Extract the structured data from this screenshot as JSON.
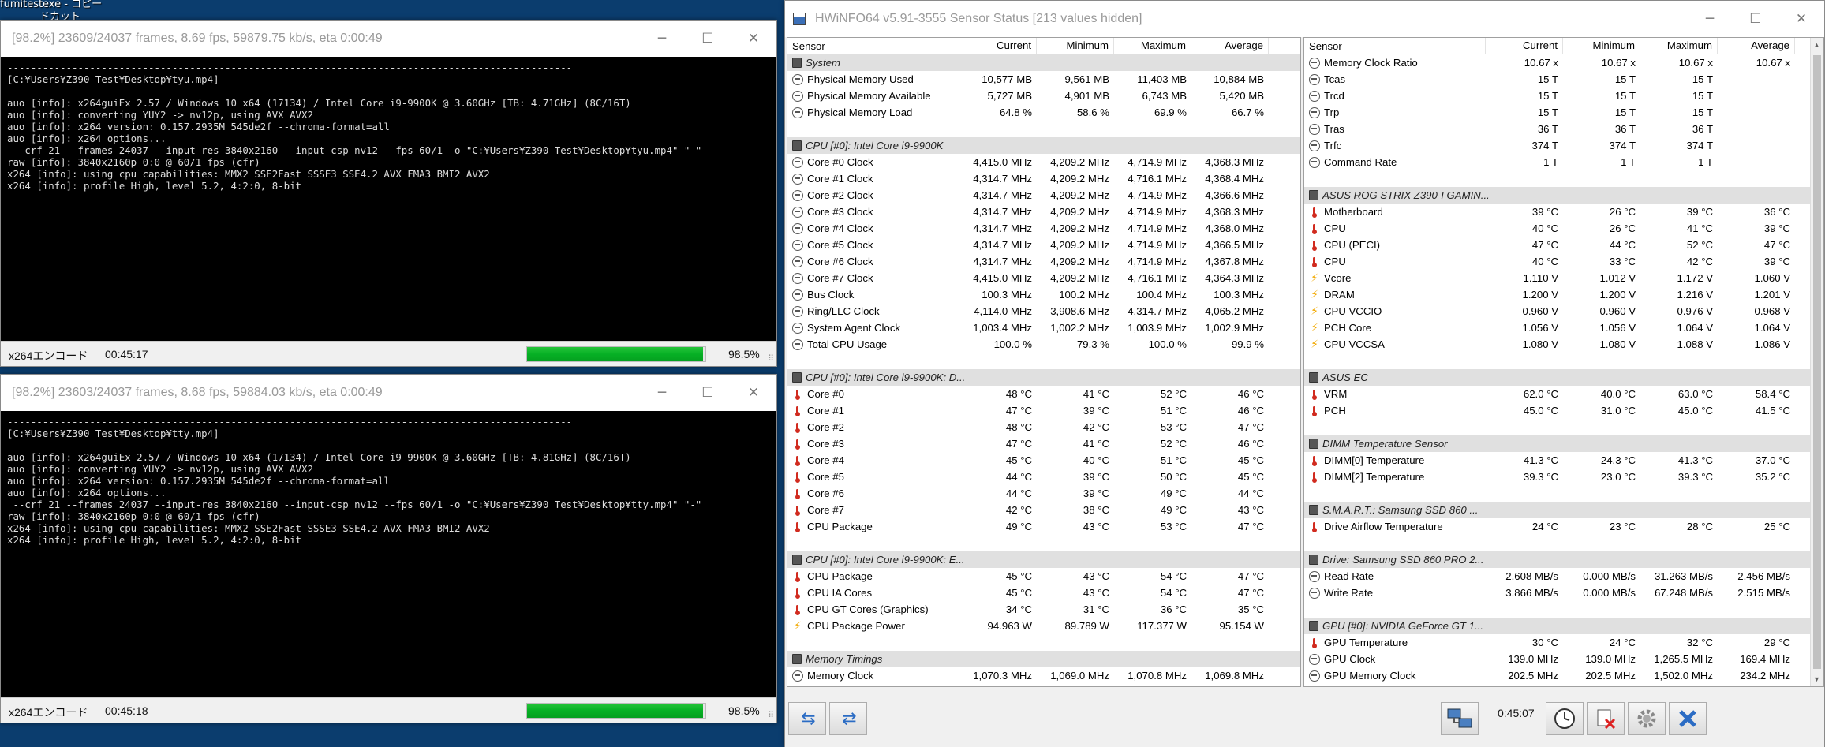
{
  "desktop": {
    "label1": "fumitestexe - コピー",
    "label2": "ドカット"
  },
  "console_windows": [
    {
      "title": "[98.2%] 23609/24037 frames, 8.69 fps, 59879.75 kb/s, eta 0:00:49",
      "lines": [
        "------------------------------------------------------------------------------------------------",
        "[C:¥Users¥Z390 Test¥Desktop¥tyu.mp4]",
        "------------------------------------------------------------------------------------------------",
        "auo [info]: x264guiEx 2.57 / Windows 10 x64 (17134) / Intel Core i9-9900K @ 3.60GHz [TB: 4.71GHz] (8C/16T)",
        "auo [info]: converting YUY2 -> nv12p, using AVX AVX2",
        "auo [info]: x264 version: 0.157.2935M 545de2f --chroma-format=all",
        "auo [info]: x264 options...",
        " --crf 21 --frames 24037 --input-res 3840x2160 --input-csp nv12 --fps 60/1 -o \"C:¥Users¥Z390 Test¥Desktop¥tyu.mp4\" \"-\"",
        "raw [info]: 3840x2160p 0:0 @ 60/1 fps (cfr)",
        "x264 [info]: using cpu capabilities: MMX2 SSE2Fast SSSE3 SSE4.2 AVX FMA3 BMI2 AVX2",
        "x264 [info]: profile High, level 5.2, 4:2:0, 8-bit"
      ],
      "status_name": "x264エンコード",
      "elapsed": "00:45:17",
      "progress": 0.985,
      "progress_text": "98.5%"
    },
    {
      "title": "[98.2%] 23603/24037 frames, 8.68 fps, 59884.03 kb/s, eta 0:00:49",
      "lines": [
        "------------------------------------------------------------------------------------------------",
        "[C:¥Users¥Z390 Test¥Desktop¥tty.mp4]",
        "------------------------------------------------------------------------------------------------",
        "auo [info]: x264guiEx 2.57 / Windows 10 x64 (17134) / Intel Core i9-9900K @ 3.60GHz [TB: 4.81GHz] (8C/16T)",
        "auo [info]: converting YUY2 -> nv12p, using AVX AVX2",
        "auo [info]: x264 version: 0.157.2935M 545de2f --chroma-format=all",
        "auo [info]: x264 options...",
        " --crf 21 --frames 24037 --input-res 3840x2160 --input-csp nv12 --fps 60/1 -o \"C:¥Users¥Z390 Test¥Desktop¥tty.mp4\" \"-\"",
        "raw [info]: 3840x2160p 0:0 @ 60/1 fps (cfr)",
        "x264 [info]: using cpu capabilities: MMX2 SSE2Fast SSSE3 SSE4.2 AVX FMA3 BMI2 AVX2",
        "x264 [info]: profile High, level 5.2, 4:2:0, 8-bit"
      ],
      "status_name": "x264エンコード",
      "elapsed": "00:45:18",
      "progress": 0.985,
      "progress_text": "98.5%"
    }
  ],
  "window_controls": {
    "minimize": "─",
    "maximize": "☐",
    "close": "✕"
  },
  "hwinfo": {
    "title": "HWiNFO64 v5.91-3555 Sensor Status [213 values hidden]",
    "headers": [
      "Sensor",
      "Current",
      "Minimum",
      "Maximum",
      "Average"
    ],
    "left_rows": [
      {
        "t": "g",
        "name": "System"
      },
      {
        "t": "s",
        "i": "circle",
        "name": "Physical Memory Used",
        "v": [
          "10,577 MB",
          "9,561 MB",
          "11,403 MB",
          "10,884 MB"
        ]
      },
      {
        "t": "s",
        "i": "circle",
        "name": "Physical Memory Available",
        "v": [
          "5,727 MB",
          "4,901 MB",
          "6,743 MB",
          "5,420 MB"
        ]
      },
      {
        "t": "s",
        "i": "circle",
        "name": "Physical Memory Load",
        "v": [
          "64.8 %",
          "58.6 %",
          "69.9 %",
          "66.7 %"
        ]
      },
      {
        "t": "b"
      },
      {
        "t": "g",
        "name": "CPU [#0]: Intel Core i9-9900K"
      },
      {
        "t": "s",
        "i": "circle",
        "name": "Core #0 Clock",
        "v": [
          "4,415.0 MHz",
          "4,209.2 MHz",
          "4,714.9 MHz",
          "4,368.3 MHz"
        ]
      },
      {
        "t": "s",
        "i": "circle",
        "name": "Core #1 Clock",
        "v": [
          "4,314.7 MHz",
          "4,209.2 MHz",
          "4,716.1 MHz",
          "4,368.4 MHz"
        ]
      },
      {
        "t": "s",
        "i": "circle",
        "name": "Core #2 Clock",
        "v": [
          "4,314.7 MHz",
          "4,209.2 MHz",
          "4,714.9 MHz",
          "4,366.6 MHz"
        ]
      },
      {
        "t": "s",
        "i": "circle",
        "name": "Core #3 Clock",
        "v": [
          "4,314.7 MHz",
          "4,209.2 MHz",
          "4,714.9 MHz",
          "4,368.3 MHz"
        ]
      },
      {
        "t": "s",
        "i": "circle",
        "name": "Core #4 Clock",
        "v": [
          "4,314.7 MHz",
          "4,209.2 MHz",
          "4,714.9 MHz",
          "4,368.0 MHz"
        ]
      },
      {
        "t": "s",
        "i": "circle",
        "name": "Core #5 Clock",
        "v": [
          "4,314.7 MHz",
          "4,209.2 MHz",
          "4,714.9 MHz",
          "4,366.5 MHz"
        ]
      },
      {
        "t": "s",
        "i": "circle",
        "name": "Core #6 Clock",
        "v": [
          "4,314.7 MHz",
          "4,209.2 MHz",
          "4,714.9 MHz",
          "4,367.8 MHz"
        ]
      },
      {
        "t": "s",
        "i": "circle",
        "name": "Core #7 Clock",
        "v": [
          "4,415.0 MHz",
          "4,209.2 MHz",
          "4,716.1 MHz",
          "4,364.3 MHz"
        ]
      },
      {
        "t": "s",
        "i": "circle",
        "name": "Bus Clock",
        "v": [
          "100.3 MHz",
          "100.2 MHz",
          "100.4 MHz",
          "100.3 MHz"
        ]
      },
      {
        "t": "s",
        "i": "circle",
        "name": "Ring/LLC Clock",
        "v": [
          "4,114.0 MHz",
          "3,908.6 MHz",
          "4,314.7 MHz",
          "4,065.2 MHz"
        ]
      },
      {
        "t": "s",
        "i": "circle",
        "name": "System Agent Clock",
        "v": [
          "1,003.4 MHz",
          "1,002.2 MHz",
          "1,003.9 MHz",
          "1,002.9 MHz"
        ]
      },
      {
        "t": "s",
        "i": "circle",
        "name": "Total CPU Usage",
        "v": [
          "100.0 %",
          "79.3 %",
          "100.0 %",
          "99.9 %"
        ]
      },
      {
        "t": "b"
      },
      {
        "t": "g",
        "name": "CPU [#0]: Intel Core i9-9900K: D..."
      },
      {
        "t": "s",
        "i": "therm",
        "name": "Core #0",
        "v": [
          "48 °C",
          "41 °C",
          "52 °C",
          "46 °C"
        ]
      },
      {
        "t": "s",
        "i": "therm",
        "name": "Core #1",
        "v": [
          "47 °C",
          "39 °C",
          "51 °C",
          "46 °C"
        ]
      },
      {
        "t": "s",
        "i": "therm",
        "name": "Core #2",
        "v": [
          "48 °C",
          "42 °C",
          "53 °C",
          "47 °C"
        ]
      },
      {
        "t": "s",
        "i": "therm",
        "name": "Core #3",
        "v": [
          "47 °C",
          "41 °C",
          "52 °C",
          "46 °C"
        ]
      },
      {
        "t": "s",
        "i": "therm",
        "name": "Core #4",
        "v": [
          "45 °C",
          "40 °C",
          "51 °C",
          "45 °C"
        ]
      },
      {
        "t": "s",
        "i": "therm",
        "name": "Core #5",
        "v": [
          "44 °C",
          "39 °C",
          "50 °C",
          "45 °C"
        ]
      },
      {
        "t": "s",
        "i": "therm",
        "name": "Core #6",
        "v": [
          "44 °C",
          "39 °C",
          "49 °C",
          "44 °C"
        ]
      },
      {
        "t": "s",
        "i": "therm",
        "name": "Core #7",
        "v": [
          "42 °C",
          "38 °C",
          "49 °C",
          "43 °C"
        ]
      },
      {
        "t": "s",
        "i": "therm",
        "name": "CPU Package",
        "v": [
          "49 °C",
          "43 °C",
          "53 °C",
          "47 °C"
        ]
      },
      {
        "t": "b"
      },
      {
        "t": "g",
        "name": "CPU [#0]: Intel Core i9-9900K: E..."
      },
      {
        "t": "s",
        "i": "therm",
        "name": "CPU Package",
        "v": [
          "45 °C",
          "43 °C",
          "54 °C",
          "47 °C"
        ]
      },
      {
        "t": "s",
        "i": "therm",
        "name": "CPU IA Cores",
        "v": [
          "45 °C",
          "43 °C",
          "54 °C",
          "47 °C"
        ]
      },
      {
        "t": "s",
        "i": "therm",
        "name": "CPU GT Cores (Graphics)",
        "v": [
          "34 °C",
          "31 °C",
          "36 °C",
          "35 °C"
        ]
      },
      {
        "t": "s",
        "i": "bolt",
        "name": "CPU Package Power",
        "v": [
          "94.963 W",
          "89.789 W",
          "117.377 W",
          "95.154 W"
        ]
      },
      {
        "t": "b"
      },
      {
        "t": "g",
        "name": "Memory Timings"
      },
      {
        "t": "s",
        "i": "circle",
        "name": "Memory Clock",
        "v": [
          "1,070.3 MHz",
          "1,069.0 MHz",
          "1,070.8 MHz",
          "1,069.8 MHz"
        ]
      }
    ],
    "right_rows": [
      {
        "t": "s",
        "i": "circle",
        "name": "Memory Clock Ratio",
        "v": [
          "10.67 x",
          "10.67 x",
          "10.67 x",
          "10.67 x"
        ]
      },
      {
        "t": "s",
        "i": "circle",
        "name": "Tcas",
        "v": [
          "15 T",
          "15 T",
          "15 T",
          ""
        ]
      },
      {
        "t": "s",
        "i": "circle",
        "name": "Trcd",
        "v": [
          "15 T",
          "15 T",
          "15 T",
          ""
        ]
      },
      {
        "t": "s",
        "i": "circle",
        "name": "Trp",
        "v": [
          "15 T",
          "15 T",
          "15 T",
          ""
        ]
      },
      {
        "t": "s",
        "i": "circle",
        "name": "Tras",
        "v": [
          "36 T",
          "36 T",
          "36 T",
          ""
        ]
      },
      {
        "t": "s",
        "i": "circle",
        "name": "Trfc",
        "v": [
          "374 T",
          "374 T",
          "374 T",
          ""
        ]
      },
      {
        "t": "s",
        "i": "circle",
        "name": "Command Rate",
        "v": [
          "1 T",
          "1 T",
          "1 T",
          ""
        ]
      },
      {
        "t": "b"
      },
      {
        "t": "g",
        "name": "ASUS ROG STRIX Z390-I GAMIN..."
      },
      {
        "t": "s",
        "i": "therm",
        "name": "Motherboard",
        "v": [
          "39 °C",
          "26 °C",
          "39 °C",
          "36 °C"
        ]
      },
      {
        "t": "s",
        "i": "therm",
        "name": "CPU",
        "v": [
          "40 °C",
          "26 °C",
          "41 °C",
          "39 °C"
        ]
      },
      {
        "t": "s",
        "i": "therm",
        "name": "CPU (PECI)",
        "v": [
          "47 °C",
          "44 °C",
          "52 °C",
          "47 °C"
        ]
      },
      {
        "t": "s",
        "i": "therm",
        "name": "CPU",
        "v": [
          "40 °C",
          "33 °C",
          "42 °C",
          "39 °C"
        ]
      },
      {
        "t": "s",
        "i": "bolt",
        "name": "Vcore",
        "v": [
          "1.110 V",
          "1.012 V",
          "1.172 V",
          "1.060 V"
        ]
      },
      {
        "t": "s",
        "i": "bolt",
        "name": "DRAM",
        "v": [
          "1.200 V",
          "1.200 V",
          "1.216 V",
          "1.201 V"
        ]
      },
      {
        "t": "s",
        "i": "bolt",
        "name": "CPU VCCIO",
        "v": [
          "0.960 V",
          "0.960 V",
          "0.976 V",
          "0.968 V"
        ]
      },
      {
        "t": "s",
        "i": "bolt",
        "name": "PCH Core",
        "v": [
          "1.056 V",
          "1.056 V",
          "1.064 V",
          "1.064 V"
        ]
      },
      {
        "t": "s",
        "i": "bolt",
        "name": "CPU VCCSA",
        "v": [
          "1.080 V",
          "1.080 V",
          "1.088 V",
          "1.086 V"
        ]
      },
      {
        "t": "b"
      },
      {
        "t": "g",
        "name": "ASUS EC"
      },
      {
        "t": "s",
        "i": "therm",
        "name": "VRM",
        "v": [
          "62.0 °C",
          "40.0 °C",
          "63.0 °C",
          "58.4 °C"
        ]
      },
      {
        "t": "s",
        "i": "therm",
        "name": "PCH",
        "v": [
          "45.0 °C",
          "31.0 °C",
          "45.0 °C",
          "41.5 °C"
        ]
      },
      {
        "t": "b"
      },
      {
        "t": "g",
        "name": "DIMM Temperature Sensor"
      },
      {
        "t": "s",
        "i": "therm",
        "name": "DIMM[0] Temperature",
        "v": [
          "41.3 °C",
          "24.3 °C",
          "41.3 °C",
          "37.0 °C"
        ]
      },
      {
        "t": "s",
        "i": "therm",
        "name": "DIMM[2] Temperature",
        "v": [
          "39.3 °C",
          "23.0 °C",
          "39.3 °C",
          "35.2 °C"
        ]
      },
      {
        "t": "b"
      },
      {
        "t": "g",
        "name": "S.M.A.R.T.: Samsung SSD 860 ..."
      },
      {
        "t": "s",
        "i": "therm",
        "name": "Drive Airflow Temperature",
        "v": [
          "24 °C",
          "23 °C",
          "28 °C",
          "25 °C"
        ]
      },
      {
        "t": "b"
      },
      {
        "t": "g",
        "name": "Drive: Samsung SSD 860 PRO 2..."
      },
      {
        "t": "s",
        "i": "circle",
        "name": "Read Rate",
        "v": [
          "2.608 MB/s",
          "0.000 MB/s",
          "31.263 MB/s",
          "2.456 MB/s"
        ]
      },
      {
        "t": "s",
        "i": "circle",
        "name": "Write Rate",
        "v": [
          "3.866 MB/s",
          "0.000 MB/s",
          "67.248 MB/s",
          "2.515 MB/s"
        ]
      },
      {
        "t": "b"
      },
      {
        "t": "g",
        "name": "GPU [#0]: NVIDIA GeForce GT 1..."
      },
      {
        "t": "s",
        "i": "therm",
        "name": "GPU Temperature",
        "v": [
          "30 °C",
          "24 °C",
          "32 °C",
          "29 °C"
        ]
      },
      {
        "t": "s",
        "i": "circle",
        "name": "GPU Clock",
        "v": [
          "139.0 MHz",
          "139.0 MHz",
          "1,265.5 MHz",
          "169.4 MHz"
        ]
      },
      {
        "t": "s",
        "i": "circle",
        "name": "GPU Memory Clock",
        "v": [
          "202.5 MHz",
          "202.5 MHz",
          "1,502.0 MHz",
          "234.2 MHz"
        ]
      }
    ],
    "footer": {
      "elapsed": "0:45:07"
    }
  }
}
